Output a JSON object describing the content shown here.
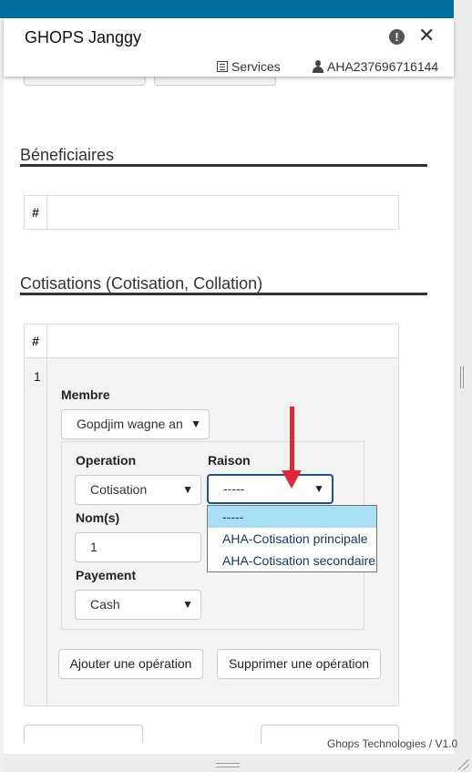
{
  "header": {
    "app_title": "GHOPS Janggy",
    "services_label": "Services",
    "user_id": "AHA237696716144"
  },
  "beneficiaires": {
    "title": "Béneficiaires",
    "table_header": "#"
  },
  "cotisations": {
    "title": "Cotisations (Cotisation, Collation)",
    "table_header": "#",
    "row_index": "1",
    "membre_label": "Membre",
    "membre_value": "Gopdjim wagne an",
    "operation_label": "Operation",
    "operation_value": "Cotisation",
    "raison_label": "Raison",
    "raison_value": "-----",
    "noms_label": "Nom(s)",
    "noms_value": "1",
    "payement_label": "Payement",
    "payement_value": "Cash",
    "raison_options": [
      "-----",
      "AHA-Cotisation principale",
      "AHA-Cotisation secondaire"
    ],
    "add_operation_label": "Ajouter une opération",
    "remove_operation_label": "Supprimer une opération"
  },
  "footer": {
    "credit": "Ghops Technologies / V1.0"
  },
  "colors": {
    "topbar": "#006f9d",
    "highlight_option": "#a8dff5",
    "annotation_arrow": "#e0283b"
  }
}
